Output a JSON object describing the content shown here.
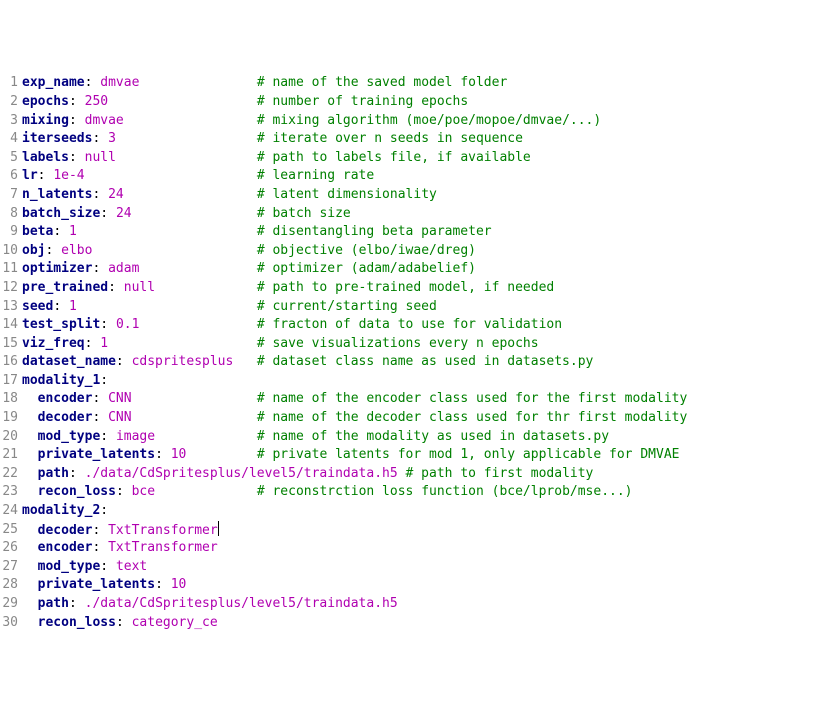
{
  "lines": [
    {
      "num": "1",
      "indent": "",
      "key": "exp_name",
      "colon": ": ",
      "val": "dmvae",
      "pad_to": 30,
      "comment": "# name of the saved model folder"
    },
    {
      "num": "2",
      "indent": "",
      "key": "epochs",
      "colon": ": ",
      "val": "250",
      "pad_to": 30,
      "comment": "# number of training epochs"
    },
    {
      "num": "3",
      "indent": "",
      "key": "mixing",
      "colon": ": ",
      "val": "dmvae",
      "pad_to": 30,
      "comment": "# mixing algorithm (moe/poe/mopoe/dmvae/...)"
    },
    {
      "num": "4",
      "indent": "",
      "key": "iterseeds",
      "colon": ": ",
      "val": "3",
      "pad_to": 30,
      "comment": "# iterate over n seeds in sequence"
    },
    {
      "num": "5",
      "indent": "",
      "key": "labels",
      "colon": ": ",
      "val": "null",
      "pad_to": 30,
      "comment": "# path to labels file, if available"
    },
    {
      "num": "6",
      "indent": "",
      "key": "lr",
      "colon": ": ",
      "val": "1e-4",
      "pad_to": 30,
      "comment": "# learning rate"
    },
    {
      "num": "7",
      "indent": "",
      "key": "n_latents",
      "colon": ": ",
      "val": "24",
      "pad_to": 30,
      "comment": "# latent dimensionality"
    },
    {
      "num": "8",
      "indent": "",
      "key": "batch_size",
      "colon": ": ",
      "val": "24",
      "pad_to": 30,
      "comment": "# batch size"
    },
    {
      "num": "9",
      "indent": "",
      "key": "beta",
      "colon": ": ",
      "val": "1",
      "pad_to": 30,
      "comment": "# disentangling beta parameter"
    },
    {
      "num": "10",
      "indent": "",
      "key": "obj",
      "colon": ": ",
      "val": "elbo",
      "pad_to": 30,
      "comment": "# objective (elbo/iwae/dreg)"
    },
    {
      "num": "11",
      "indent": "",
      "key": "optimizer",
      "colon": ": ",
      "val": "adam",
      "pad_to": 30,
      "comment": "# optimizer (adam/adabelief)"
    },
    {
      "num": "12",
      "indent": "",
      "key": "pre_trained",
      "colon": ": ",
      "val": "null",
      "pad_to": 30,
      "comment": "# path to pre-trained model, if needed"
    },
    {
      "num": "13",
      "indent": "",
      "key": "seed",
      "colon": ": ",
      "val": "1",
      "pad_to": 30,
      "comment": "# current/starting seed"
    },
    {
      "num": "14",
      "indent": "",
      "key": "test_split",
      "colon": ": ",
      "val": "0.1",
      "pad_to": 30,
      "comment": "# fracton of data to use for validation"
    },
    {
      "num": "15",
      "indent": "",
      "key": "viz_freq",
      "colon": ": ",
      "val": "1",
      "pad_to": 30,
      "comment": "# save visualizations every n epochs"
    },
    {
      "num": "16",
      "indent": "",
      "key": "dataset_name",
      "colon": ": ",
      "val": "cdspritesplus",
      "pad_to": 30,
      "comment": "# dataset class name as used in datasets.py"
    },
    {
      "num": "17",
      "indent": "",
      "key": "modality_1",
      "colon": ":",
      "val": "",
      "pad_to": 0,
      "comment": ""
    },
    {
      "num": "18",
      "indent": "  ",
      "key": "encoder",
      "colon": ": ",
      "val": "CNN",
      "pad_to": 30,
      "comment": "# name of the encoder class used for the first modality"
    },
    {
      "num": "19",
      "indent": "  ",
      "key": "decoder",
      "colon": ": ",
      "val": "CNN",
      "pad_to": 30,
      "comment": "# name of the decoder class used for thr first modality"
    },
    {
      "num": "20",
      "indent": "  ",
      "key": "mod_type",
      "colon": ": ",
      "val": "image",
      "pad_to": 30,
      "comment": "# name of the modality as used in datasets.py"
    },
    {
      "num": "21",
      "indent": "  ",
      "key": "private_latents",
      "colon": ": ",
      "val": "10",
      "pad_to": 30,
      "comment": "# private latents for mod 1, only applicable for DMVAE"
    },
    {
      "num": "22",
      "indent": "  ",
      "key": "path",
      "colon": ": ",
      "val": "./data/CdSpritesplus/level5/traindata.h5",
      "pad_to": 0,
      "comment": " # path to first modality"
    },
    {
      "num": "23",
      "indent": "  ",
      "key": "recon_loss",
      "colon": ": ",
      "val": "bce",
      "pad_to": 30,
      "comment": "# reconstrction loss function (bce/lprob/mse...)"
    },
    {
      "num": "24",
      "indent": "",
      "key": "modality_2",
      "colon": ":",
      "val": "",
      "pad_to": 0,
      "comment": ""
    },
    {
      "num": "25",
      "indent": "  ",
      "key": "decoder",
      "colon": ": ",
      "val": "TxtTransformer",
      "pad_to": 0,
      "comment": "",
      "cursor": true
    },
    {
      "num": "26",
      "indent": "  ",
      "key": "encoder",
      "colon": ": ",
      "val": "TxtTransformer",
      "pad_to": 0,
      "comment": ""
    },
    {
      "num": "27",
      "indent": "  ",
      "key": "mod_type",
      "colon": ": ",
      "val": "text",
      "pad_to": 0,
      "comment": ""
    },
    {
      "num": "28",
      "indent": "  ",
      "key": "private_latents",
      "colon": ": ",
      "val": "10",
      "pad_to": 0,
      "comment": ""
    },
    {
      "num": "29",
      "indent": "  ",
      "key": "path",
      "colon": ": ",
      "val": "./data/CdSpritesplus/level5/traindata.h5",
      "pad_to": 0,
      "comment": ""
    },
    {
      "num": "30",
      "indent": "  ",
      "key": "recon_loss",
      "colon": ": ",
      "val": "category_ce",
      "pad_to": 0,
      "comment": ""
    }
  ]
}
